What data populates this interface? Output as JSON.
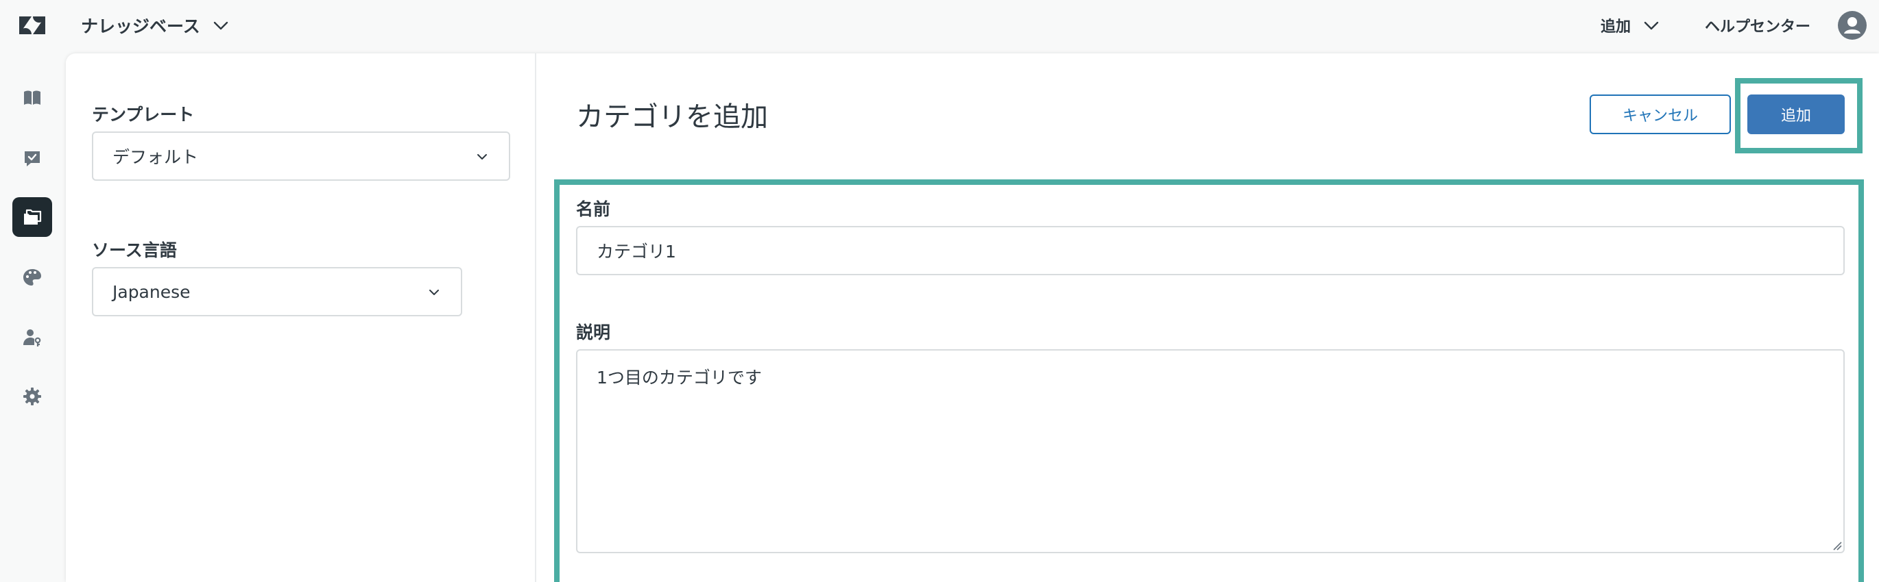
{
  "header": {
    "product_name": "ナレッジベース",
    "add_label": "追加",
    "help_center_label": "ヘルプセンター"
  },
  "nav": {
    "items": [
      {
        "icon": "book-icon",
        "active": false
      },
      {
        "icon": "checked-message-icon",
        "active": false
      },
      {
        "icon": "folders-icon",
        "active": true
      },
      {
        "icon": "palette-icon",
        "active": false
      },
      {
        "icon": "user-key-icon",
        "active": false
      },
      {
        "icon": "gear-icon",
        "active": false
      }
    ]
  },
  "settings": {
    "template_label": "テンプレート",
    "template_value": "デフォルト",
    "source_language_label": "ソース言語",
    "source_language_value": "Japanese"
  },
  "form": {
    "title": "カテゴリを追加",
    "cancel_label": "キャンセル",
    "submit_label": "追加",
    "name_label": "名前",
    "name_value": "カテゴリ1",
    "description_label": "説明",
    "description_value": "1つ目のカテゴリです"
  },
  "colors": {
    "primary": "#1f73b7",
    "submit_bg": "#3a77b8",
    "highlight": "#4bada3",
    "nav_active": "#1f2a30"
  }
}
